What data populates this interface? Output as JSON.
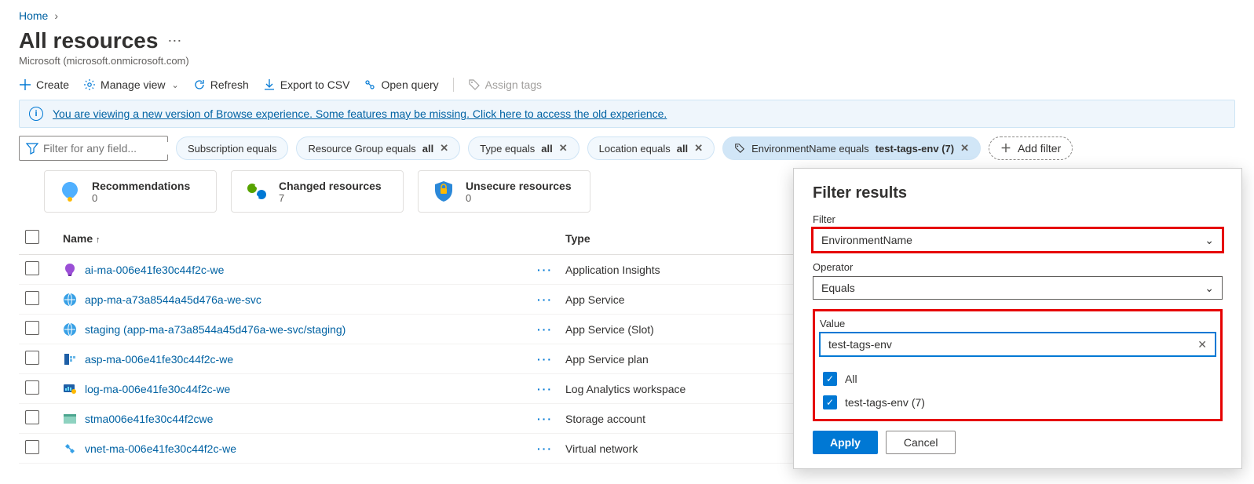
{
  "breadcrumb": {
    "home": "Home"
  },
  "title": "All resources",
  "tenant": "Microsoft (microsoft.onmicrosoft.com)",
  "toolbar": {
    "create": "Create",
    "manage_view": "Manage view",
    "refresh": "Refresh",
    "export_csv": "Export to CSV",
    "open_query": "Open query",
    "assign_tags": "Assign tags"
  },
  "infobar": "You are viewing a new version of Browse experience. Some features may be missing. Click here to access the old experience.",
  "search_placeholder": "Filter for any field...",
  "pills": {
    "subscription": "Subscription equals",
    "rg_prefix": "Resource Group equals ",
    "rg_val": "all",
    "type_prefix": "Type equals ",
    "type_val": "all",
    "loc_prefix": "Location equals ",
    "loc_val": "all",
    "env_prefix": "EnvironmentName equals ",
    "env_val": "test-tags-env (7)",
    "add_filter": "Add filter"
  },
  "cards": {
    "reco_t": "Recommendations",
    "reco_v": "0",
    "chg_t": "Changed resources",
    "chg_v": "7",
    "unsec_t": "Unsecure resources",
    "unsec_v": "0"
  },
  "columns": {
    "name": "Name",
    "type": "Type"
  },
  "rows": [
    {
      "name": "ai-ma-006e41fe30c44f2c-we",
      "type": "Application Insights",
      "icon": "appinsights"
    },
    {
      "name": "app-ma-a73a8544a45d476a-we-svc",
      "type": "App Service",
      "icon": "appservice"
    },
    {
      "name": "staging (app-ma-a73a8544a45d476a-we-svc/staging)",
      "type": "App Service (Slot)",
      "icon": "appservice"
    },
    {
      "name": "asp-ma-006e41fe30c44f2c-we",
      "type": "App Service plan",
      "icon": "appserviceplan"
    },
    {
      "name": "log-ma-006e41fe30c44f2c-we",
      "type": "Log Analytics workspace",
      "icon": "loganalytics"
    },
    {
      "name": "stma006e41fe30c44f2cwe",
      "type": "Storage account",
      "icon": "storage"
    },
    {
      "name": "vnet-ma-006e41fe30c44f2c-we",
      "type": "Virtual network",
      "icon": "vnet"
    }
  ],
  "popup": {
    "title": "Filter results",
    "filter_label": "Filter",
    "filter_value": "EnvironmentName",
    "operator_label": "Operator",
    "operator_value": "Equals",
    "value_label": "Value",
    "value_text": "test-tags-env",
    "opt_all": "All",
    "opt_env": "test-tags-env (7)",
    "apply": "Apply",
    "cancel": "Cancel"
  }
}
